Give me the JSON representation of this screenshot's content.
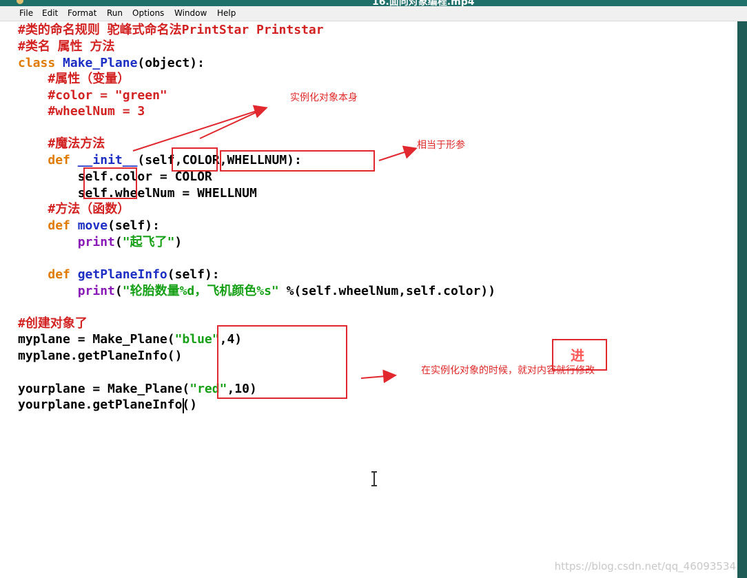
{
  "window": {
    "title": "16.面向对象编程.mp4"
  },
  "menu": [
    "File",
    "Edit",
    "Format",
    "Run",
    "Options",
    "Window",
    "Help"
  ],
  "code_lines": [
    [
      {
        "t": "#类的命名规则 驼峰式命名法PrintStar Printstar",
        "c": "cm"
      }
    ],
    [
      {
        "t": "#类名 属性 方法",
        "c": "cm"
      }
    ],
    [
      {
        "t": "class",
        "c": "kw"
      },
      {
        "t": " "
      },
      {
        "t": "Make_Plane",
        "c": "fn"
      },
      {
        "t": "(object):"
      }
    ],
    [
      {
        "t": "    "
      },
      {
        "t": "#属性（变量）",
        "c": "cm"
      }
    ],
    [
      {
        "t": "    "
      },
      {
        "t": "#color = \"green\"",
        "c": "cm"
      }
    ],
    [
      {
        "t": "    "
      },
      {
        "t": "#wheelNum = 3",
        "c": "cm"
      }
    ],
    [],
    [
      {
        "t": "    "
      },
      {
        "t": "#魔法方法",
        "c": "cm"
      }
    ],
    [
      {
        "t": "    "
      },
      {
        "t": "def",
        "c": "kw"
      },
      {
        "t": " "
      },
      {
        "t": "__init__",
        "c": "fn"
      },
      {
        "t": "(self,COLOR,WHELLNUM):"
      }
    ],
    [
      {
        "t": "        self.color = COLOR"
      }
    ],
    [
      {
        "t": "        self.wheelNum = WHELLNUM"
      }
    ],
    [
      {
        "t": "    "
      },
      {
        "t": "#方法（函数）",
        "c": "cm"
      }
    ],
    [
      {
        "t": "    "
      },
      {
        "t": "def",
        "c": "kw"
      },
      {
        "t": " "
      },
      {
        "t": "move",
        "c": "fn"
      },
      {
        "t": "(self):"
      }
    ],
    [
      {
        "t": "        "
      },
      {
        "t": "print",
        "c": "bi"
      },
      {
        "t": "("
      },
      {
        "t": "\"起飞了\"",
        "c": "st"
      },
      {
        "t": ")"
      }
    ],
    [],
    [
      {
        "t": "    "
      },
      {
        "t": "def",
        "c": "kw"
      },
      {
        "t": " "
      },
      {
        "t": "getPlaneInfo",
        "c": "fn"
      },
      {
        "t": "(self):"
      }
    ],
    [
      {
        "t": "        "
      },
      {
        "t": "print",
        "c": "bi"
      },
      {
        "t": "("
      },
      {
        "t": "\"轮胎数量%d，飞机颜色%s\"",
        "c": "st"
      },
      {
        "t": " %(self.wheelNum,self.color))"
      }
    ],
    [],
    [
      {
        "t": "#创建对象了",
        "c": "cm"
      }
    ],
    [
      {
        "t": "myplane = Make_Plane("
      },
      {
        "t": "\"blue\"",
        "c": "st"
      },
      {
        "t": ",4)"
      }
    ],
    [
      {
        "t": "myplane.getPlaneInfo()"
      }
    ],
    [],
    [
      {
        "t": "yourplane = Make_Plane("
      },
      {
        "t": "\"red\"",
        "c": "st"
      },
      {
        "t": ",10)"
      }
    ],
    [
      {
        "t": "yourplane.getPlaneInfo()"
      }
    ]
  ],
  "annotations": {
    "instance_self": "实例化对象本身",
    "formal_params": "相当于形参",
    "modify_on_instantiate": "在实例化对象的时候，就对内容就行修改",
    "jin_label": "进"
  },
  "watermark": "https://blog.csdn.net/qq_46093534"
}
